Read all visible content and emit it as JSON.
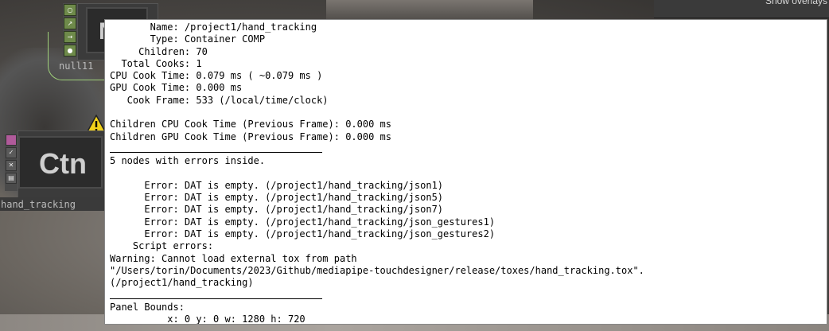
{
  "top_bar": {
    "label": "Show overlays"
  },
  "nodes": [
    {
      "id": "null11",
      "icon_text": "N",
      "label": "null11"
    },
    {
      "id": "hand_tracking",
      "icon_text": "Ctn",
      "label": "hand_tracking"
    }
  ],
  "info": {
    "lines": [
      "       Name: /project1/hand_tracking",
      "       Type: Container COMP",
      "     Children: 70",
      "  Total Cooks: 1",
      "CPU Cook Time: 0.079 ms ( ~0.079 ms )",
      "GPU Cook Time: 0.000 ms",
      "   Cook Frame: 533 (/local/time/clock)",
      "",
      "Children CPU Cook Time (Previous Frame): 0.000 ms",
      "Children GPU Cook Time (Previous Frame): 0.000 ms",
      "__SEP__",
      "5 nodes with errors inside.",
      "",
      "      Error: DAT is empty. (/project1/hand_tracking/json1)",
      "      Error: DAT is empty. (/project1/hand_tracking/json5)",
      "      Error: DAT is empty. (/project1/hand_tracking/json7)",
      "      Error: DAT is empty. (/project1/hand_tracking/json_gestures1)",
      "      Error: DAT is empty. (/project1/hand_tracking/json_gestures2)",
      "    Script errors:",
      "Warning: Cannot load external tox from path",
      "\"/Users/torin/Documents/2023/Github/mediapipe-touchdesigner/release/toxes/hand_tracking.tox\".",
      "(/project1/hand_tracking)",
      "__SEP__",
      "Panel Bounds:",
      "          x: 0 y: 0 w: 1280 h: 720"
    ]
  },
  "colors": {
    "panel_bg": "#ffffff",
    "node_tool_green": "#6e8a4a",
    "wire": "#9fd07a",
    "warning": "#f2d21a"
  }
}
